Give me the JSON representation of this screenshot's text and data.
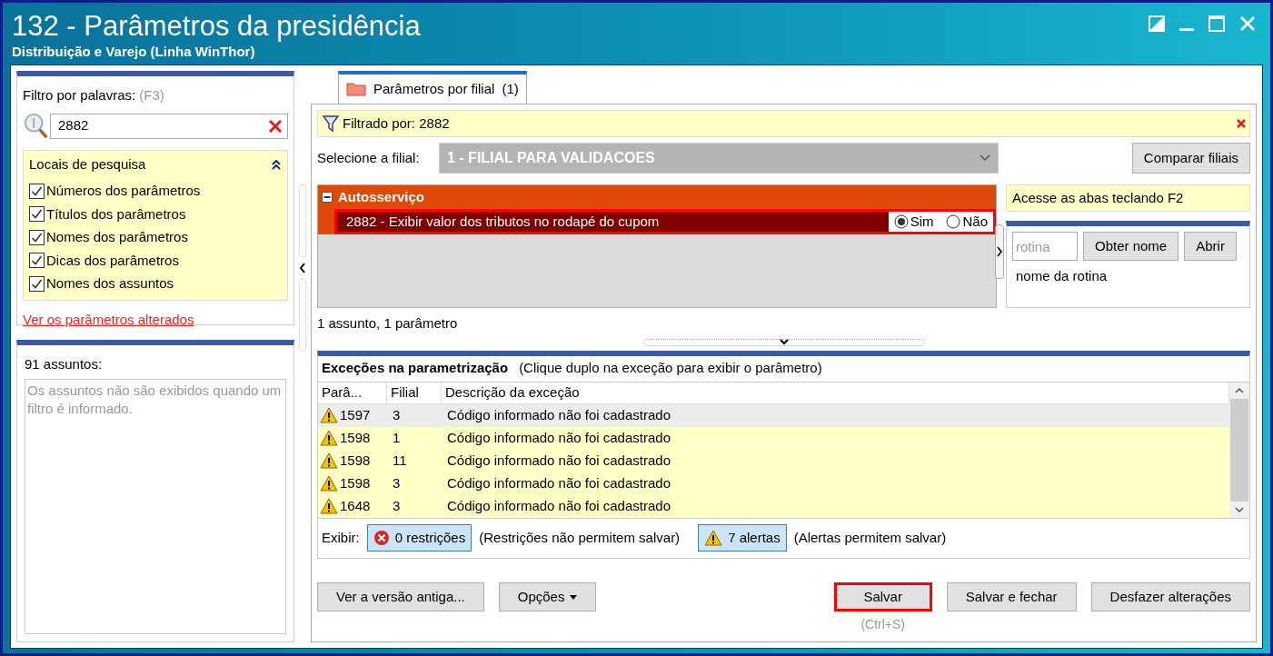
{
  "window": {
    "title": "132 - Parâmetros da presidência",
    "subtitle": "Distribuição e Varejo (Linha WinThor)"
  },
  "filter_panel": {
    "label": "Filtro por palavras:",
    "shortcut": "(F3)",
    "search": {
      "value": "2882"
    },
    "search_places": {
      "title": "Locais de pesquisa",
      "expanded": true,
      "options": [
        {
          "label": "Números dos parâmetros",
          "checked": true
        },
        {
          "label": "Títulos dos parâmetros",
          "checked": true
        },
        {
          "label": "Nomes dos parâmetros",
          "checked": true
        },
        {
          "label": "Dicas dos parâmetros",
          "checked": true
        },
        {
          "label": "Nomes dos assuntos",
          "checked": true
        }
      ]
    },
    "link": "Ver os parâmetros alterados"
  },
  "subjects_panel": {
    "count_label": "91 assuntos:",
    "message": "Os assuntos não são exibidos quando um filtro é informado."
  },
  "tabs": [
    {
      "label": "Parâmetros por filial",
      "count": "(1)",
      "selected": true
    }
  ],
  "filter_bar": {
    "text": "Filtrado por: 2882"
  },
  "branch": {
    "label": "Selecione a filial:",
    "value": "1 - FILIAL PARA VALIDACOES",
    "disabled": true
  },
  "compare_button": "Comparar filiais",
  "params": {
    "groups": [
      {
        "title": "Autosserviço",
        "expanded": true,
        "items": [
          {
            "text": "2882 - Exibir valor dos tributos no rodapé do cupom",
            "highlighted": true,
            "options": [
              {
                "label": "Sim",
                "selected": true
              },
              {
                "label": "Não",
                "selected": false
              }
            ]
          }
        ]
      }
    ],
    "summary": "1 assunto, 1 parâmetro"
  },
  "hint": "Acesse as abas teclando F2",
  "routine": {
    "placeholder": "rotina",
    "buttons": [
      "Obter nome",
      "Abrir"
    ],
    "name_label": "nome da rotina"
  },
  "exceptions": {
    "title": "Exceções na parametrização",
    "subtitle": "(Clique duplo na exceção para exibir o parâmetro)",
    "columns": [
      "Parâ...",
      "Filial",
      "Descrição da exceção"
    ],
    "rows": [
      {
        "param": "1597",
        "branch": "3",
        "description": "Código informado não foi cadastrado",
        "selected": true
      },
      {
        "param": "1598",
        "branch": "1",
        "description": "Código informado não foi cadastrado",
        "selected": false
      },
      {
        "param": "1598",
        "branch": "11",
        "description": "Código informado não foi cadastrado",
        "selected": false
      },
      {
        "param": "1598",
        "branch": "3",
        "description": "Código informado não foi cadastrado",
        "selected": false
      },
      {
        "param": "1648",
        "branch": "3",
        "description": "Código informado não foi cadastrado",
        "selected": false
      }
    ],
    "show_label": "Exibir:",
    "toggles": [
      {
        "kind": "error",
        "label": "0 restrições",
        "note": "(Restrições não permitem salvar)"
      },
      {
        "kind": "warning",
        "label": "7 alertas",
        "note": "(Alertas permitem salvar)"
      }
    ]
  },
  "footer": {
    "left_buttons": [
      {
        "label": "Ver a versão antiga...",
        "kind": "plain"
      },
      {
        "label": "Opções",
        "kind": "menu"
      }
    ],
    "right_buttons": [
      {
        "label": "Salvar",
        "highlighted": true,
        "hint": "(Ctrl+S)"
      },
      {
        "label": "Salvar e fechar",
        "highlighted": false
      },
      {
        "label": "Desfazer alterações",
        "highlighted": false
      }
    ]
  }
}
